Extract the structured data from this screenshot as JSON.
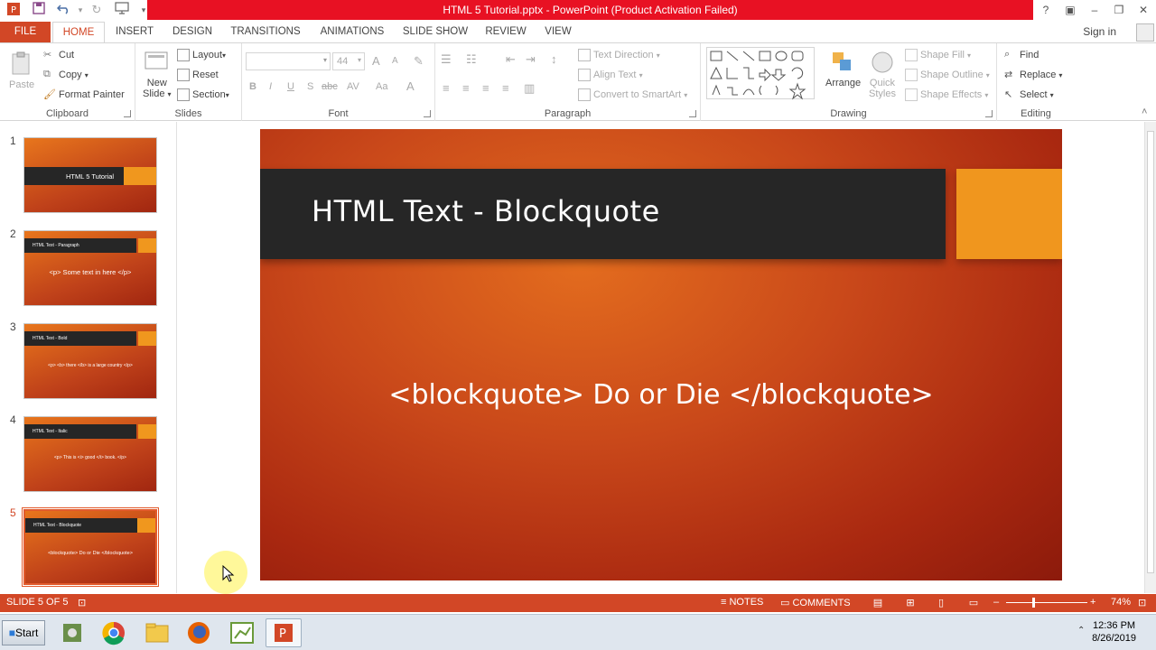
{
  "window": {
    "title": "HTML 5 Tutorial.pptx -  PowerPoint (Product Activation Failed)"
  },
  "tabs": [
    {
      "label": "FILE"
    },
    {
      "label": "HOME"
    },
    {
      "label": "INSERT"
    },
    {
      "label": "DESIGN"
    },
    {
      "label": "TRANSITIONS"
    },
    {
      "label": "ANIMATIONS"
    },
    {
      "label": "SLIDE SHOW"
    },
    {
      "label": "REVIEW"
    },
    {
      "label": "VIEW"
    }
  ],
  "signin": "Sign in",
  "ribbon": {
    "clipboard": {
      "label": "Clipboard",
      "paste": "Paste",
      "cut": "Cut",
      "copy": "Copy",
      "format_painter": "Format Painter"
    },
    "slides": {
      "label": "Slides",
      "new_slide_1": "New",
      "new_slide_2": "Slide",
      "layout": "Layout",
      "reset": "Reset",
      "section": "Section"
    },
    "font": {
      "label": "Font",
      "size": "44",
      "bold": "B",
      "italic": "I",
      "underline": "U",
      "shadow": "S",
      "strike": "abc",
      "spacing": "AV",
      "case": "Aa",
      "color": "A",
      "grow": "A",
      "shrink": "A"
    },
    "paragraph": {
      "label": "Paragraph",
      "text_direction": "Text Direction",
      "align_text": "Align Text",
      "convert_smartart": "Convert to SmartArt"
    },
    "drawing": {
      "label": "Drawing",
      "arrange": "Arrange",
      "quick_styles_1": "Quick",
      "quick_styles_2": "Styles",
      "shape_fill": "Shape Fill",
      "shape_outline": "Shape Outline",
      "shape_effects": "Shape Effects"
    },
    "editing": {
      "label": "Editing",
      "find": "Find",
      "replace": "Replace",
      "select": "Select"
    }
  },
  "thumbnails": [
    {
      "num": "1",
      "title": "HTML 5 Tutorial",
      "body": ""
    },
    {
      "num": "2",
      "title": "HTML Text - Paragraph",
      "body": "<p> Some text in here </p>"
    },
    {
      "num": "3",
      "title": "HTML Text - Bold",
      "body": "<p> <b> there </b> is a large country </p>"
    },
    {
      "num": "4",
      "title": "HTML Text - Italic",
      "body": "<p> This is <i> good </i> book. </p>"
    },
    {
      "num": "5",
      "title": "HTML Text - Blockquote",
      "body": "<blockquote> Do or Die </blockquote>"
    }
  ],
  "slide": {
    "title": "HTML Text - Blockquote",
    "body": "<blockquote> Do or Die </blockquote>"
  },
  "status": {
    "slide_count": "SLIDE 5 OF 5",
    "notes": "NOTES",
    "comments": "COMMENTS",
    "zoom": "74%"
  },
  "taskbar": {
    "start": "Start",
    "time": "12:36 PM",
    "date": "8/26/2019"
  },
  "colors": {
    "accent": "#d24726",
    "title_bar": "#e81123",
    "slide_orange": "#f0961e",
    "slide_dark_bar": "#262626"
  }
}
